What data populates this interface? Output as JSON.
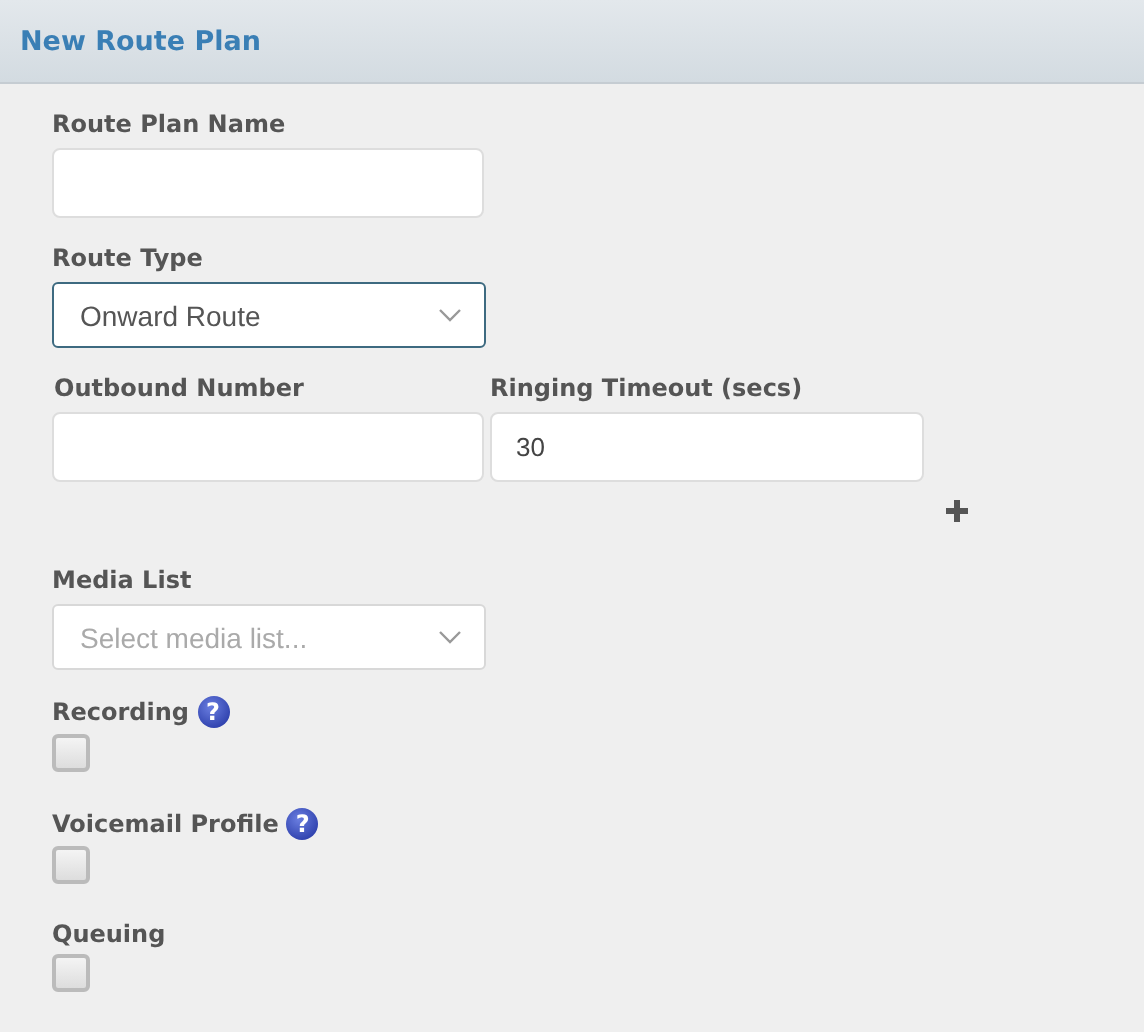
{
  "title": "New Route Plan",
  "form": [
    {
      "kind": "text",
      "label": "Route Plan Name"
    },
    {
      "kind": "select",
      "label": "Route Type",
      "value": "Onward Route",
      "focused": true
    },
    {
      "kind": "row",
      "fields": [
        {
          "kind": "text",
          "label": "Outbound Number"
        },
        {
          "kind": "text",
          "label": "Ringing Timeout (secs)",
          "value": "30"
        }
      ]
    },
    {
      "kind": "add"
    },
    {
      "kind": "select",
      "label": "Media List",
      "placeholder": "Select media list...",
      "focused": false
    },
    {
      "kind": "checkbox",
      "label": "Recording",
      "help": "?",
      "checked": false
    },
    {
      "kind": "checkbox",
      "label": "Voicemail Profile",
      "help": "?",
      "checked": false
    },
    {
      "kind": "checkbox",
      "label": "Queuing",
      "checked": false
    }
  ]
}
